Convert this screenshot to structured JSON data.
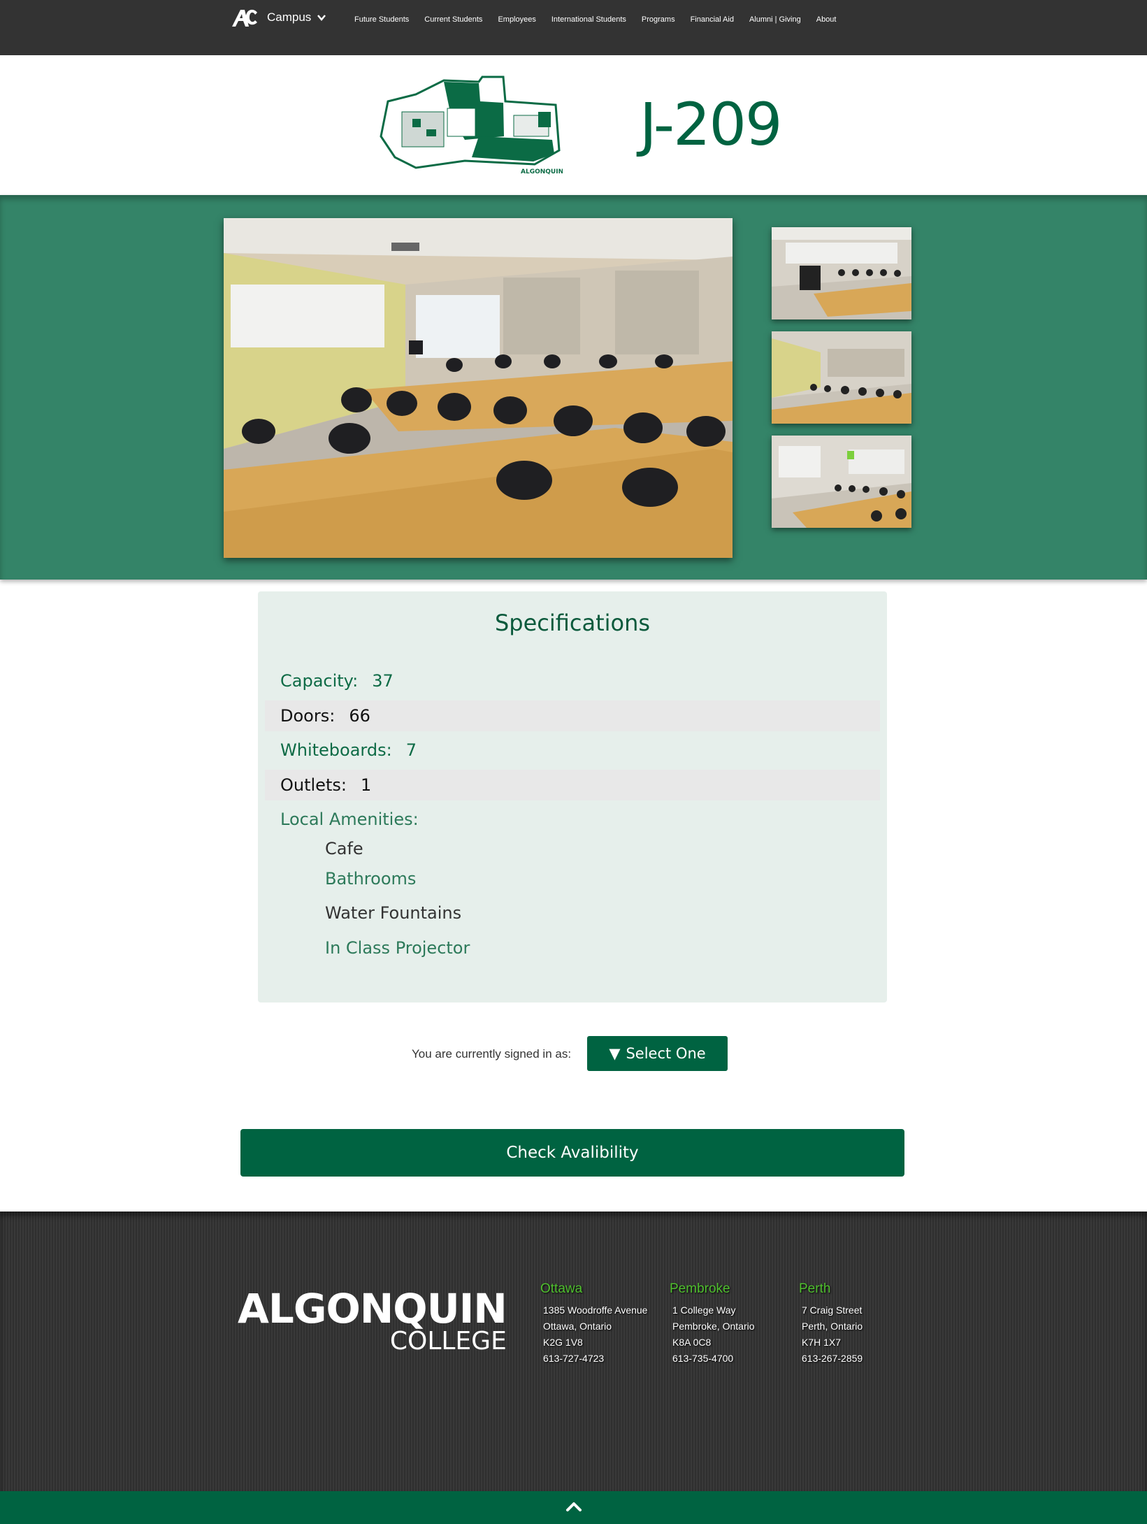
{
  "nav": {
    "campus_label": "Campus",
    "links": [
      "Future Students",
      "Current Students",
      "Employees",
      "International Students",
      "Programs",
      "Financial Aid",
      "Alumni | Giving",
      "About"
    ]
  },
  "header": {
    "map_text": "ALGONQUIN",
    "room": "J-209"
  },
  "specs": {
    "title": "Specifications",
    "rows": [
      {
        "label": "Capacity:",
        "value": "37"
      },
      {
        "label": "Doors:",
        "value": "66"
      },
      {
        "label": "Whiteboards:",
        "value": "7"
      },
      {
        "label": "Outlets:",
        "value": "1"
      }
    ],
    "amenities_label": "Local Amenities:",
    "amenities": [
      "Cafe",
      "Bathrooms",
      "Water Fountains",
      "In Class Projector"
    ]
  },
  "signin": {
    "label": "You are currently signed in as:",
    "select_label": "Select One",
    "select_arrow": "▼"
  },
  "check_label": "Check Avalibility",
  "footer": {
    "logo_line1": "ALGONQUIN",
    "logo_line2": "COLLEGE",
    "locations": [
      {
        "city": "Ottawa",
        "lines": [
          "1385 Woodroffe Avenue",
          "Ottawa, Ontario",
          "K2G 1V8",
          "613-727-4723"
        ]
      },
      {
        "city": "Pembroke",
        "lines": [
          "1 College Way",
          "Pembroke, Ontario",
          "K8A 0C8",
          "613-735-4700"
        ]
      },
      {
        "city": "Perth",
        "lines": [
          "7 Craig Street",
          "Perth, Ontario",
          "K7H 1X7",
          "613-267-2859"
        ]
      }
    ]
  },
  "icons": {
    "brand": "ac-logo-icon",
    "dropdown": "chevron-down-icon",
    "scroll_top": "chevron-up-icon"
  },
  "colors": {
    "brand_green": "#006341",
    "band_green": "#348468",
    "nav_dark": "#333333",
    "accent_light_green": "#4fbf2e"
  }
}
